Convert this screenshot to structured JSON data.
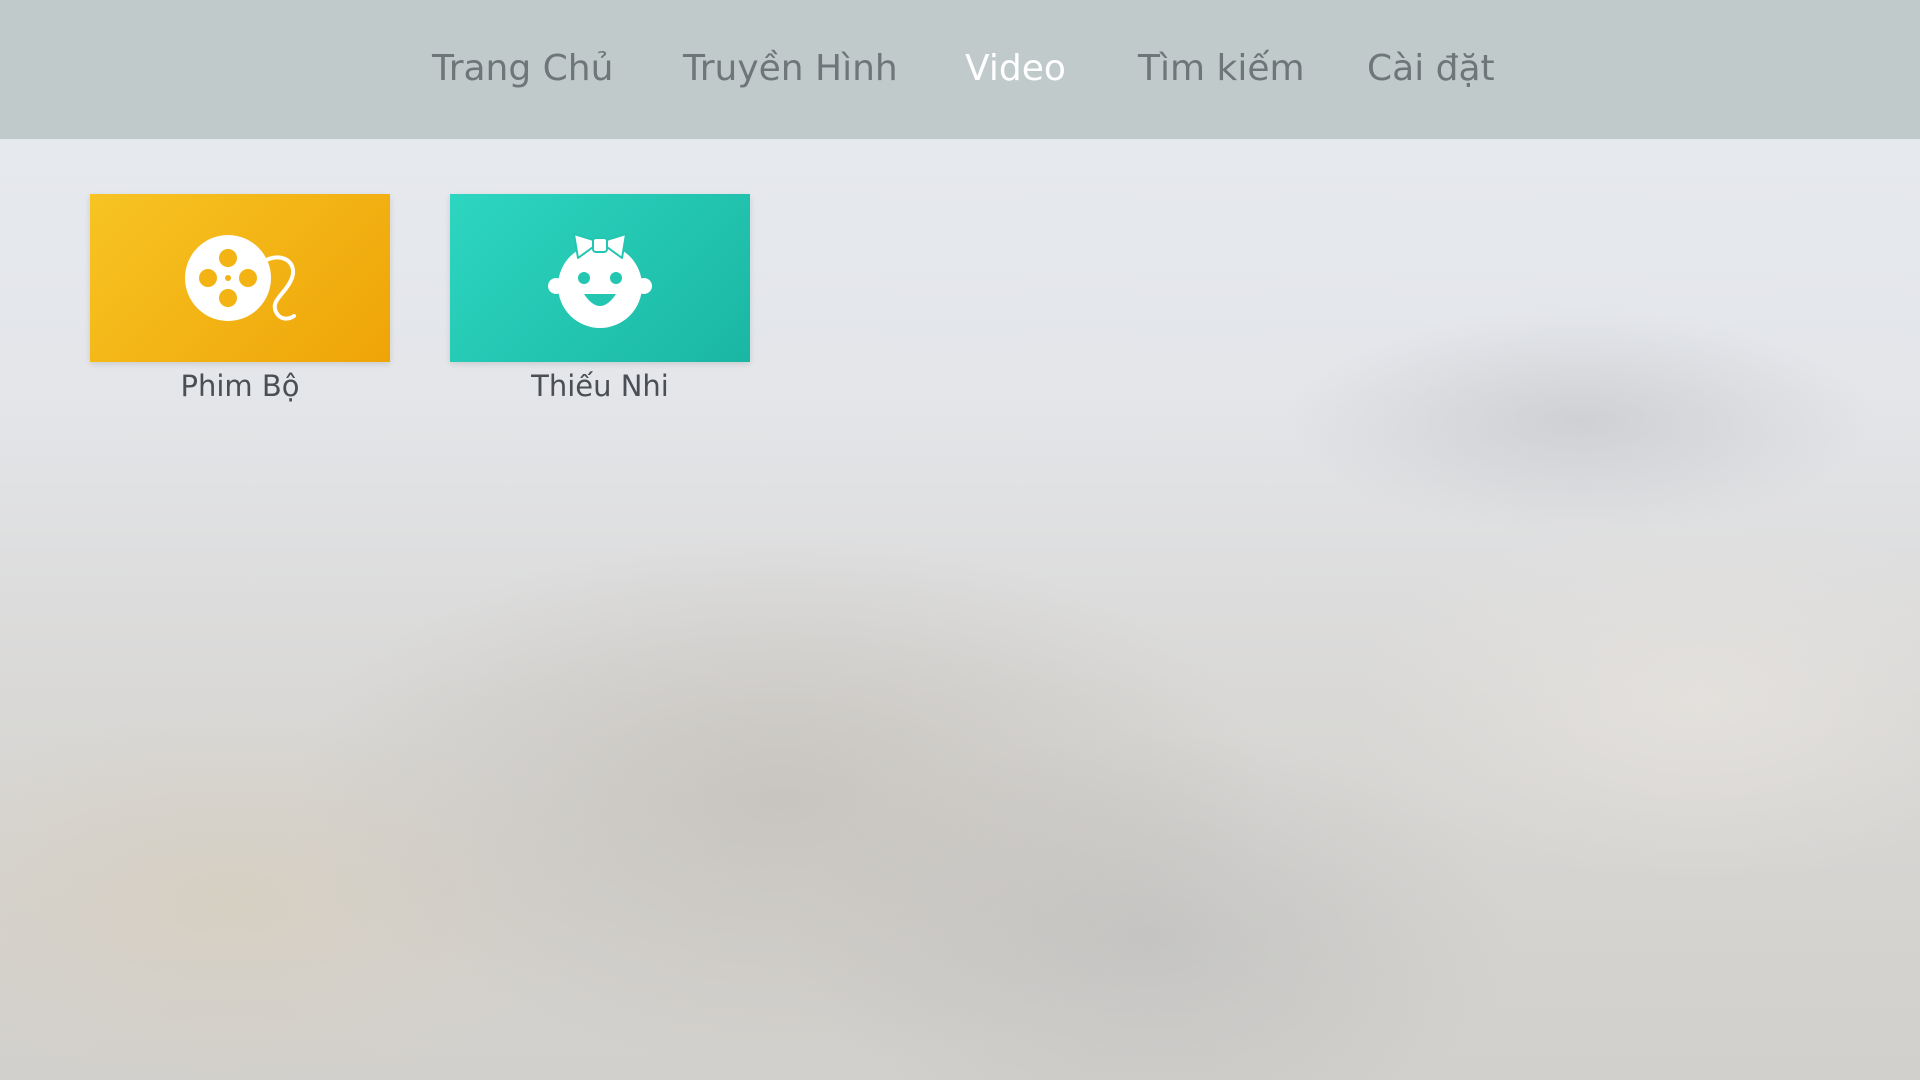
{
  "nav": {
    "items": [
      {
        "label": "Trang Chủ",
        "active": false
      },
      {
        "label": "Truyền Hình",
        "active": false
      },
      {
        "label": "Video",
        "active": true
      },
      {
        "label": "Tìm kiếm",
        "active": false
      },
      {
        "label": "Cài đặt",
        "active": false
      }
    ]
  },
  "tiles": [
    {
      "label": "Phim Bộ",
      "icon": "film-reel-icon",
      "color_start": "#f7c423",
      "color_end": "#efa407"
    },
    {
      "label": "Thiếu Nhi",
      "icon": "baby-face-icon",
      "color_start": "#2dd6c0",
      "color_end": "#1ab7a3"
    }
  ],
  "colors": {
    "topbar": "#c0cacb",
    "nav_inactive": "#6f7679",
    "nav_active": "#ffffff",
    "tile_label": "#4a4f55"
  }
}
